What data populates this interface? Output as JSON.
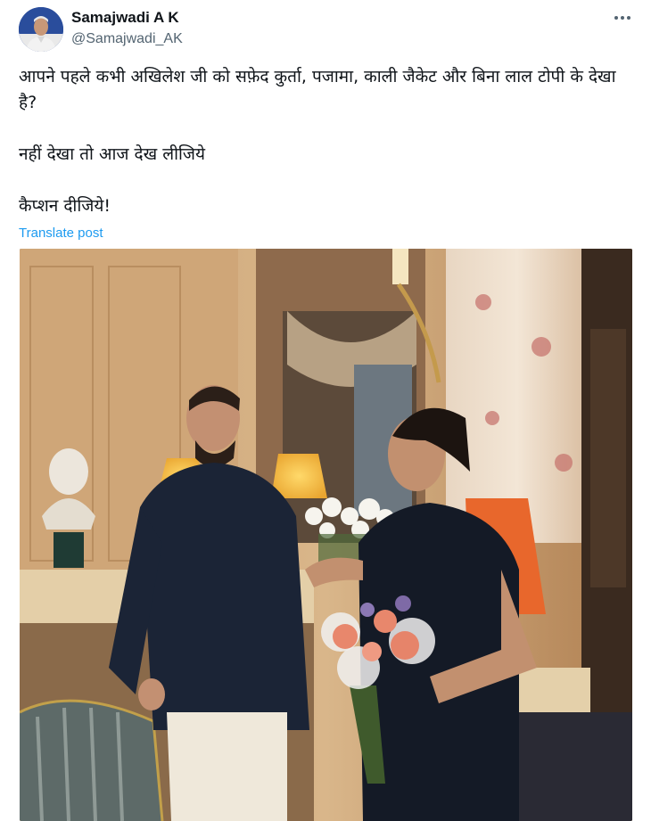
{
  "author": {
    "display_name": "Samajwadi A K",
    "handle": "@Samajwadi_AK",
    "avatar_icon": "profile-photo"
  },
  "menu": {
    "icon": "more-horizontal-icon"
  },
  "post": {
    "lines": [
      "आपने पहले कभी अखिलेश जी को सफ़ेद कुर्ता, पजामा, काली जैकेट और बिना लाल टोपी के देखा है?",
      "नहीं देखा तो आज देख लीजिये",
      "कैप्शन दीजिये!"
    ],
    "translate_label": "Translate post"
  },
  "colors": {
    "link": "#1d9bf0",
    "secondary_text": "#536471",
    "primary_text": "#0f1419"
  }
}
